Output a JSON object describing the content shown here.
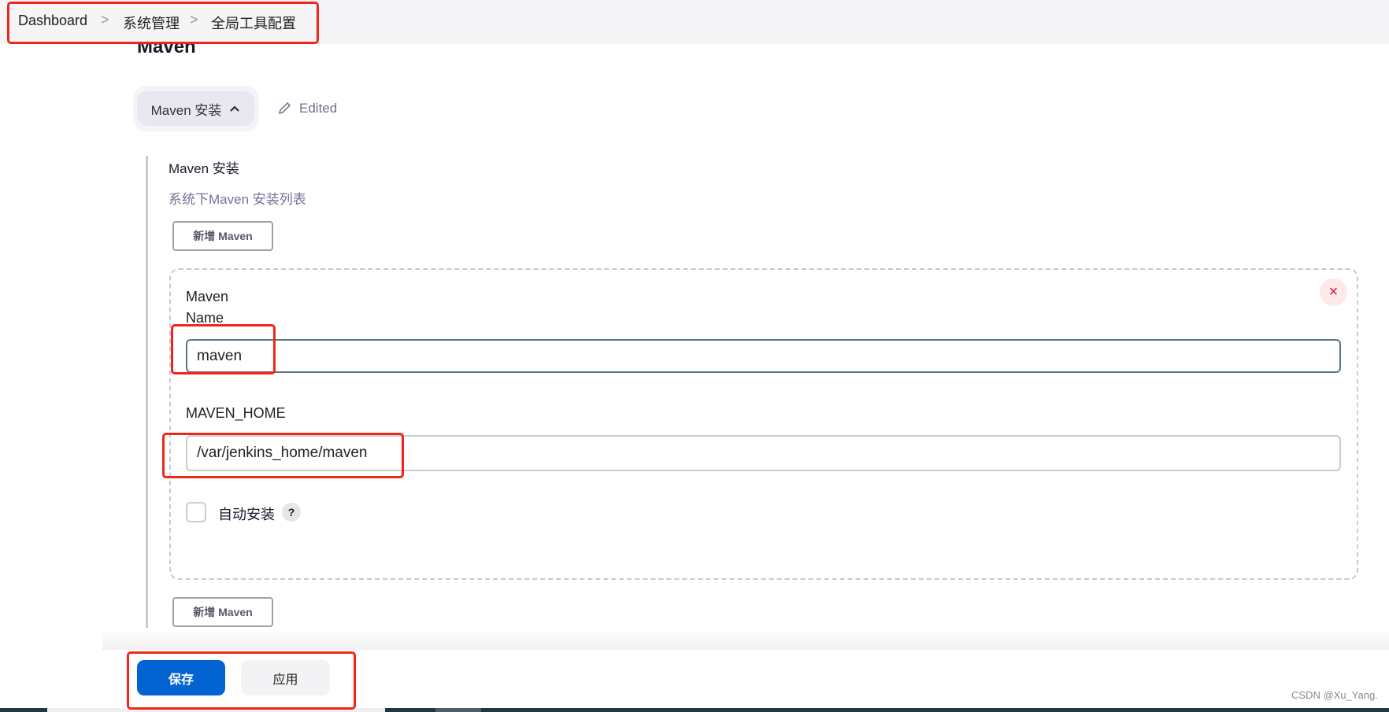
{
  "breadcrumb": {
    "items": [
      "Dashboard",
      "系统管理",
      "全局工具配置"
    ],
    "separator": ">"
  },
  "page": {
    "section_title": "Maven"
  },
  "toggle": {
    "label": "Maven 安装",
    "chevron": "chevron-up-icon",
    "status": "Edited"
  },
  "installations": {
    "label": "Maven 安装",
    "description": "系统下Maven 安装列表",
    "add_label": "新增 Maven",
    "item": {
      "name_label": "Maven\nName",
      "name_label_line1": "Maven",
      "name_label_line2": "Name",
      "name_value": "maven",
      "home_label": "MAVEN_HOME",
      "home_value": "/var/jenkins_home/maven",
      "auto_install_label": "自动安装",
      "auto_install_checked": false,
      "help": "?",
      "close": "×"
    }
  },
  "footer": {
    "save_label": "保存",
    "apply_label": "应用"
  },
  "watermark": "CSDN @Xu_Yang.",
  "colors": {
    "primary": "#0263d1",
    "danger": "#e0123a",
    "annotation": "#f0261b"
  }
}
